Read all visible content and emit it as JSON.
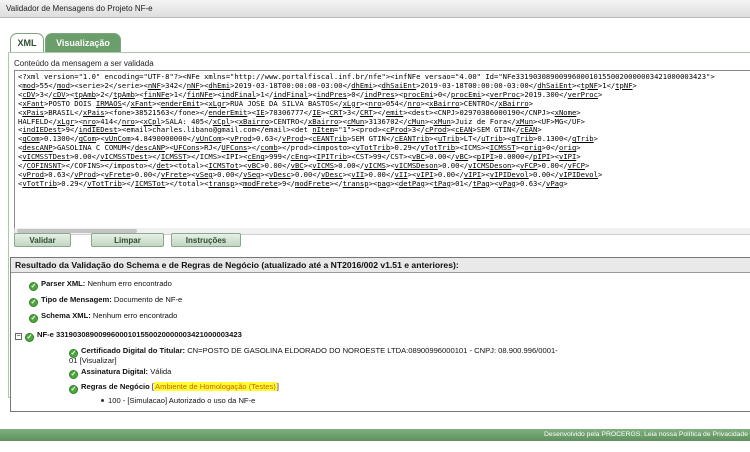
{
  "window": {
    "title": "Validador de Mensagens do Projeto NF-e"
  },
  "tabs": [
    {
      "label": "XML",
      "active": true
    },
    {
      "label": "Visualização",
      "active": false
    }
  ],
  "content_label": "Conteúdo da mensagem a ser validada",
  "xml_lines": [
    [
      {
        "t": "<?xml version=\"1.0\" encoding=\"UTF-8\"?><NFe xmlns=\"http://www.portalfiscal.inf.br/nfe\"><infNFe versao=\"4.00\" Id=\"NFe33190308900996000101550020000003421000003423\">",
        "u": false
      }
    ],
    [
      {
        "t": "<",
        "u": false
      },
      {
        "t": "mod",
        "u": true
      },
      {
        "t": ">55</",
        "u": false
      },
      {
        "t": "mod",
        "u": true
      },
      {
        "t": "><serie>2</serie><",
        "u": false
      },
      {
        "t": "nNF",
        "u": true
      },
      {
        "t": ">342</",
        "u": false
      },
      {
        "t": "nNF",
        "u": true
      },
      {
        "t": "><",
        "u": false
      },
      {
        "t": "dhEmi",
        "u": true
      },
      {
        "t": ">2019-03-18T00:00:00-03:00</",
        "u": false
      },
      {
        "t": "dhEmi",
        "u": true
      },
      {
        "t": "><",
        "u": false
      },
      {
        "t": "dhSaiEnt",
        "u": true
      },
      {
        "t": ">2019-03-18T00:00:00-03:00</",
        "u": false
      },
      {
        "t": "dhSaiEnt",
        "u": true
      },
      {
        "t": "><",
        "u": false
      },
      {
        "t": "tpNF",
        "u": true
      },
      {
        "t": ">1</",
        "u": false
      },
      {
        "t": "tpNF",
        "u": true
      },
      {
        "t": ">",
        "u": false
      }
    ],
    [
      {
        "t": "<",
        "u": false
      },
      {
        "t": "cDV",
        "u": true
      },
      {
        "t": ">3</",
        "u": false
      },
      {
        "t": "cDV",
        "u": true
      },
      {
        "t": "><",
        "u": false
      },
      {
        "t": "tpAmb",
        "u": true
      },
      {
        "t": ">2</",
        "u": false
      },
      {
        "t": "tpAmb",
        "u": true
      },
      {
        "t": "><",
        "u": false
      },
      {
        "t": "finNFe",
        "u": true
      },
      {
        "t": ">1</",
        "u": false
      },
      {
        "t": "finNFe",
        "u": true
      },
      {
        "t": "><",
        "u": false
      },
      {
        "t": "indFinal",
        "u": true
      },
      {
        "t": ">1</",
        "u": false
      },
      {
        "t": "indFinal",
        "u": true
      },
      {
        "t": "><",
        "u": false
      },
      {
        "t": "indPres",
        "u": true
      },
      {
        "t": ">0</",
        "u": false
      },
      {
        "t": "indPres",
        "u": true
      },
      {
        "t": "><",
        "u": false
      },
      {
        "t": "procEmi",
        "u": true
      },
      {
        "t": ">0</",
        "u": false
      },
      {
        "t": "procEmi",
        "u": true
      },
      {
        "t": "><",
        "u": false
      },
      {
        "t": "verProc",
        "u": true
      },
      {
        "t": ">2019.300</",
        "u": false
      },
      {
        "t": "verProc",
        "u": true
      },
      {
        "t": ">",
        "u": false
      }
    ],
    [
      {
        "t": "<",
        "u": false
      },
      {
        "t": "xFant",
        "u": true
      },
      {
        "t": ">POSTO DOIS ",
        "u": false
      },
      {
        "t": "IRMAOS",
        "u": true
      },
      {
        "t": "</",
        "u": false
      },
      {
        "t": "xFant",
        "u": true
      },
      {
        "t": "><",
        "u": false
      },
      {
        "t": "enderEmit",
        "u": true
      },
      {
        "t": "><",
        "u": false
      },
      {
        "t": "xLgr",
        "u": true
      },
      {
        "t": ">RUA JOSE DA SILVA BASTOS</",
        "u": false
      },
      {
        "t": "xLgr",
        "u": true
      },
      {
        "t": "><",
        "u": false
      },
      {
        "t": "nro",
        "u": true
      },
      {
        "t": ">054</",
        "u": false
      },
      {
        "t": "nro",
        "u": true
      },
      {
        "t": "><",
        "u": false
      },
      {
        "t": "xBairro",
        "u": true
      },
      {
        "t": ">CENTRO</",
        "u": false
      },
      {
        "t": "xBairro",
        "u": true
      },
      {
        "t": ">",
        "u": false
      }
    ],
    [
      {
        "t": "<",
        "u": false
      },
      {
        "t": "xPais",
        "u": true
      },
      {
        "t": ">BRASIL</",
        "u": false
      },
      {
        "t": "xPais",
        "u": true
      },
      {
        "t": "><fone>38521563</fone></",
        "u": false
      },
      {
        "t": "enderEmit",
        "u": true
      },
      {
        "t": "><",
        "u": false
      },
      {
        "t": "IE",
        "u": true
      },
      {
        "t": ">78306777</",
        "u": false
      },
      {
        "t": "IE",
        "u": true
      },
      {
        "t": "><",
        "u": false
      },
      {
        "t": "CRT",
        "u": true
      },
      {
        "t": ">3</",
        "u": false
      },
      {
        "t": "CRT",
        "u": true
      },
      {
        "t": "></",
        "u": false
      },
      {
        "t": "emit",
        "u": true
      },
      {
        "t": "><dest><CNPJ>02970386000190</CNPJ><",
        "u": false
      },
      {
        "t": "xNome",
        "u": true
      },
      {
        "t": ">",
        "u": false
      }
    ],
    [
      {
        "t": "HALFELD</",
        "u": false
      },
      {
        "t": "xLgr",
        "u": true
      },
      {
        "t": "><",
        "u": false
      },
      {
        "t": "nro",
        "u": true
      },
      {
        "t": ">414</",
        "u": false
      },
      {
        "t": "nro",
        "u": true
      },
      {
        "t": "><",
        "u": false
      },
      {
        "t": "xCpl",
        "u": true
      },
      {
        "t": ">SALA: 405</",
        "u": false
      },
      {
        "t": "xCpl",
        "u": true
      },
      {
        "t": "><",
        "u": false
      },
      {
        "t": "xBairro",
        "u": true
      },
      {
        "t": ">CENTRO</",
        "u": false
      },
      {
        "t": "xBairro",
        "u": true
      },
      {
        "t": "><",
        "u": false
      },
      {
        "t": "cMun",
        "u": true
      },
      {
        "t": ">3136702</",
        "u": false
      },
      {
        "t": "cMun",
        "u": true
      },
      {
        "t": "><",
        "u": false
      },
      {
        "t": "xMun",
        "u": true
      },
      {
        "t": ">Juiz de Fora</",
        "u": false
      },
      {
        "t": "xMun",
        "u": true
      },
      {
        "t": "><UF>MG</UF>",
        "u": false
      }
    ],
    [
      {
        "t": "<",
        "u": false
      },
      {
        "t": "indIEDest",
        "u": true
      },
      {
        "t": ">9</",
        "u": false
      },
      {
        "t": "indIEDest",
        "u": true
      },
      {
        "t": "><email>charles.libano@gmail.com</email><det ",
        "u": false
      },
      {
        "t": "nItem",
        "u": true
      },
      {
        "t": "=\"1\"><prod><",
        "u": false
      },
      {
        "t": "cProd",
        "u": true
      },
      {
        "t": ">3</",
        "u": false
      },
      {
        "t": "cProd",
        "u": true
      },
      {
        "t": "><",
        "u": false
      },
      {
        "t": "cEAN",
        "u": true
      },
      {
        "t": ">SEM GTIN</",
        "u": false
      },
      {
        "t": "cEAN",
        "u": true
      },
      {
        "t": ">",
        "u": false
      }
    ],
    [
      {
        "t": "<",
        "u": false
      },
      {
        "t": "qCom",
        "u": true
      },
      {
        "t": ">0.1300</",
        "u": false
      },
      {
        "t": "qCom",
        "u": true
      },
      {
        "t": "><",
        "u": false
      },
      {
        "t": "vUnCom",
        "u": true
      },
      {
        "t": ">4.8490000000</",
        "u": false
      },
      {
        "t": "vUnCom",
        "u": true
      },
      {
        "t": "><",
        "u": false
      },
      {
        "t": "vProd",
        "u": true
      },
      {
        "t": ">0.63</",
        "u": false
      },
      {
        "t": "vProd",
        "u": true
      },
      {
        "t": "><",
        "u": false
      },
      {
        "t": "cEANTrib",
        "u": true
      },
      {
        "t": ">SEM GTIN</",
        "u": false
      },
      {
        "t": "cEANTrib",
        "u": true
      },
      {
        "t": "><",
        "u": false
      },
      {
        "t": "uTrib",
        "u": true
      },
      {
        "t": ">LT</",
        "u": false
      },
      {
        "t": "uTrib",
        "u": true
      },
      {
        "t": "><",
        "u": false
      },
      {
        "t": "qTrib",
        "u": true
      },
      {
        "t": ">0.1300</",
        "u": false
      },
      {
        "t": "qTrib",
        "u": true
      },
      {
        "t": ">",
        "u": false
      }
    ],
    [
      {
        "t": "<",
        "u": false
      },
      {
        "t": "descANP",
        "u": true
      },
      {
        "t": ">GASOLINA C COMUM</",
        "u": false
      },
      {
        "t": "descANP",
        "u": true
      },
      {
        "t": "><",
        "u": false
      },
      {
        "t": "UFCons",
        "u": true
      },
      {
        "t": ">RJ</",
        "u": false
      },
      {
        "t": "UFCons",
        "u": true
      },
      {
        "t": "></",
        "u": false
      },
      {
        "t": "comb",
        "u": true
      },
      {
        "t": "></prod><imposto><",
        "u": false
      },
      {
        "t": "vTotTrib",
        "u": true
      },
      {
        "t": ">0.29</",
        "u": false
      },
      {
        "t": "vTotTrib",
        "u": true
      },
      {
        "t": "><ICMS><",
        "u": false
      },
      {
        "t": "ICMSST",
        "u": true
      },
      {
        "t": "><",
        "u": false
      },
      {
        "t": "orig",
        "u": true
      },
      {
        "t": ">0</",
        "u": false
      },
      {
        "t": "orig",
        "u": true
      },
      {
        "t": ">",
        "u": false
      }
    ],
    [
      {
        "t": "<",
        "u": false
      },
      {
        "t": "vICMSSTDest",
        "u": true
      },
      {
        "t": ">0.00</",
        "u": false
      },
      {
        "t": "vICMSSTDest",
        "u": true
      },
      {
        "t": "></",
        "u": false
      },
      {
        "t": "ICMSST",
        "u": true
      },
      {
        "t": "></ICMS><IPI><",
        "u": false
      },
      {
        "t": "cEnq",
        "u": true
      },
      {
        "t": ">999</",
        "u": false
      },
      {
        "t": "cEnq",
        "u": true
      },
      {
        "t": "><",
        "u": false
      },
      {
        "t": "IPITrib",
        "u": true
      },
      {
        "t": "><CST>99</CST><",
        "u": false
      },
      {
        "t": "vBC",
        "u": true
      },
      {
        "t": ">0.00</",
        "u": false
      },
      {
        "t": "vBC",
        "u": true
      },
      {
        "t": "><",
        "u": false
      },
      {
        "t": "pIPI",
        "u": true
      },
      {
        "t": ">0.0000</",
        "u": false
      },
      {
        "t": "pIPI",
        "u": true
      },
      {
        "t": "><",
        "u": false
      },
      {
        "t": "vIPI",
        "u": true
      },
      {
        "t": ">",
        "u": false
      }
    ],
    [
      {
        "t": "</",
        "u": false
      },
      {
        "t": "COFINSNT",
        "u": true
      },
      {
        "t": "></COFINS></imposto></",
        "u": false
      },
      {
        "t": "det",
        "u": true
      },
      {
        "t": "><total><",
        "u": false
      },
      {
        "t": "ICMSTot",
        "u": true
      },
      {
        "t": "><",
        "u": false
      },
      {
        "t": "vBC",
        "u": true
      },
      {
        "t": ">0.00</",
        "u": false
      },
      {
        "t": "vBC",
        "u": true
      },
      {
        "t": "><",
        "u": false
      },
      {
        "t": "vICMS",
        "u": true
      },
      {
        "t": ">0.00</",
        "u": false
      },
      {
        "t": "vICMS",
        "u": true
      },
      {
        "t": "><",
        "u": false
      },
      {
        "t": "vICMSDeson",
        "u": true
      },
      {
        "t": ">0.00</",
        "u": false
      },
      {
        "t": "vICMSDeson",
        "u": true
      },
      {
        "t": "><",
        "u": false
      },
      {
        "t": "vFCP",
        "u": true
      },
      {
        "t": ">0.00</",
        "u": false
      },
      {
        "t": "vFCP",
        "u": true
      },
      {
        "t": ">",
        "u": false
      }
    ],
    [
      {
        "t": "<",
        "u": false
      },
      {
        "t": "vProd",
        "u": true
      },
      {
        "t": ">0.63</",
        "u": false
      },
      {
        "t": "vProd",
        "u": true
      },
      {
        "t": "><",
        "u": false
      },
      {
        "t": "vFrete",
        "u": true
      },
      {
        "t": ">0.00</",
        "u": false
      },
      {
        "t": "vFrete",
        "u": true
      },
      {
        "t": "><",
        "u": false
      },
      {
        "t": "vSeg",
        "u": true
      },
      {
        "t": ">0.00</",
        "u": false
      },
      {
        "t": "vSeg",
        "u": true
      },
      {
        "t": "><",
        "u": false
      },
      {
        "t": "vDesc",
        "u": true
      },
      {
        "t": ">0.00</",
        "u": false
      },
      {
        "t": "vDesc",
        "u": true
      },
      {
        "t": "><",
        "u": false
      },
      {
        "t": "vII",
        "u": true
      },
      {
        "t": ">0.00</",
        "u": false
      },
      {
        "t": "vII",
        "u": true
      },
      {
        "t": "><",
        "u": false
      },
      {
        "t": "vIPI",
        "u": true
      },
      {
        "t": ">0.00</",
        "u": false
      },
      {
        "t": "vIPI",
        "u": true
      },
      {
        "t": "><",
        "u": false
      },
      {
        "t": "vIPIDevol",
        "u": true
      },
      {
        "t": ">0.00</",
        "u": false
      },
      {
        "t": "vIPIDevol",
        "u": true
      },
      {
        "t": ">",
        "u": false
      }
    ],
    [
      {
        "t": "<",
        "u": false
      },
      {
        "t": "vTotTrib",
        "u": true
      },
      {
        "t": ">0.29</",
        "u": false
      },
      {
        "t": "vTotTrib",
        "u": true
      },
      {
        "t": "></",
        "u": false
      },
      {
        "t": "ICMSTot",
        "u": true
      },
      {
        "t": "></total><",
        "u": false
      },
      {
        "t": "transp",
        "u": true
      },
      {
        "t": "><",
        "u": false
      },
      {
        "t": "modFrete",
        "u": true
      },
      {
        "t": ">9</",
        "u": false
      },
      {
        "t": "modFrete",
        "u": true
      },
      {
        "t": "></",
        "u": false
      },
      {
        "t": "transp",
        "u": true
      },
      {
        "t": "><",
        "u": false
      },
      {
        "t": "pag",
        "u": true
      },
      {
        "t": "><",
        "u": false
      },
      {
        "t": "detPag",
        "u": true
      },
      {
        "t": "><",
        "u": false
      },
      {
        "t": "tPag",
        "u": true
      },
      {
        "t": ">01</",
        "u": false
      },
      {
        "t": "tPag",
        "u": true
      },
      {
        "t": "><",
        "u": false
      },
      {
        "t": "vPag",
        "u": true
      },
      {
        "t": ">0.63</",
        "u": false
      },
      {
        "t": "vPag",
        "u": true
      },
      {
        "t": ">",
        "u": false
      }
    ]
  ],
  "buttons": {
    "validar": "Validar",
    "limpar": "Limpar",
    "instrucoes": "Instruções"
  },
  "result": {
    "header": "Resultado da Validação do Schema e de Regras de Negócio (atualizado até a NT2016/002 v1.51 e anteriores):",
    "parser": {
      "label": "Parser XML:",
      "value": "Nenhum erro encontrado"
    },
    "tipo": {
      "label": "Tipo de Mensagem:",
      "value": "Documento de NF-e"
    },
    "schema": {
      "label": "Schema XML:",
      "value": "Nenhum erro encontrado"
    },
    "nfe": {
      "toggle": "−",
      "label": "NF-e 33190308900996000101550020000003421000003423"
    },
    "certificado": {
      "label": "Certificado Digital do Titular:",
      "value": "CN=POSTO DE GASOLINA ELDORADO DO NOROESTE LTDA:08900996000101 - CNPJ: 08.900.996/0001-",
      "value2": "01",
      "link": "[Visualizar]"
    },
    "assinatura": {
      "label": "Assinatura Digital:",
      "value": "Válida"
    },
    "regras": {
      "label": "Regras de Negócio",
      "bracket_open": "[",
      "highlight": "Ambiente de Homologação (Testes)",
      "bracket_close": "]"
    },
    "status_item": "100 - [Simulacao] Autorizado o uso da NF-e"
  },
  "footer": {
    "text": "Desenvolvido pela PROCERGS. Leia nossa Política de Privacidade"
  },
  "colors": {
    "tab_active_green": "#6a9e6a",
    "ok_green": "#4caa3c",
    "footer_green": "#6a9e6a",
    "highlight_yellow": "#ffff33",
    "highlight_text": "#d06000"
  }
}
